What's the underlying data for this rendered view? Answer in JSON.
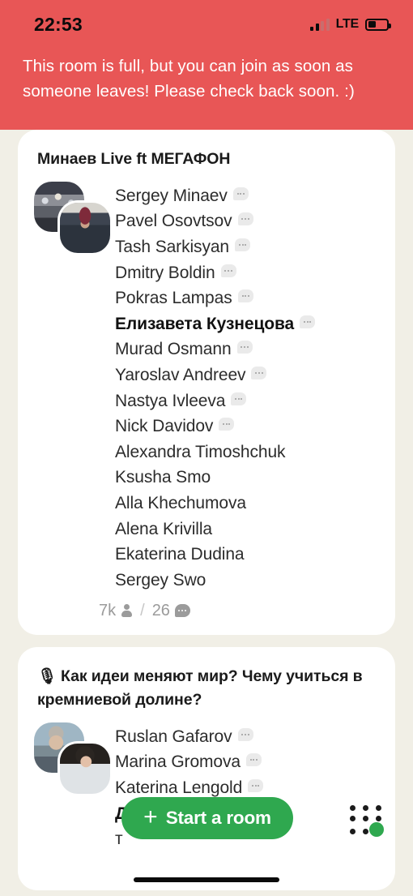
{
  "status_bar": {
    "time": "22:53",
    "network_label": "LTE",
    "signal_icon": "signal-bars-icon",
    "battery_icon": "battery-low-icon"
  },
  "banner": {
    "message": "This room is full, but you can join as soon as someone leaves! Please check back soon. :)",
    "background_color": "#E85656",
    "text_color": "#FFFFFF"
  },
  "rooms": [
    {
      "title": "Минаев Live ft МЕГАФОН",
      "has_mic_icon": false,
      "avatars": [
        "crowd-photo-avatar",
        "man-in-red-hat-avatar"
      ],
      "participants": [
        {
          "name": "Sergey Minaev",
          "has_bubble": true,
          "speaking": false
        },
        {
          "name": "Pavel Osovtsov",
          "has_bubble": true,
          "speaking": false
        },
        {
          "name": "Tash Sarkisyan",
          "has_bubble": true,
          "speaking": false
        },
        {
          "name": "Dmitry Boldin",
          "has_bubble": true,
          "speaking": false
        },
        {
          "name": "Pokras Lampas",
          "has_bubble": true,
          "speaking": false
        },
        {
          "name": "Елизавета Кузнецова",
          "has_bubble": true,
          "speaking": true
        },
        {
          "name": "Murad Osmann",
          "has_bubble": true,
          "speaking": false
        },
        {
          "name": "Yaroslav Andreev",
          "has_bubble": true,
          "speaking": false
        },
        {
          "name": "Nastya Ivleeva",
          "has_bubble": true,
          "speaking": false
        },
        {
          "name": "Nick Davidov",
          "has_bubble": true,
          "speaking": false
        },
        {
          "name": "Alexandra Timoshchuk",
          "has_bubble": false,
          "speaking": false
        },
        {
          "name": "Ksusha Smo",
          "has_bubble": false,
          "speaking": false
        },
        {
          "name": "Alla Khechumova",
          "has_bubble": false,
          "speaking": false
        },
        {
          "name": "Alena Krivilla",
          "has_bubble": false,
          "speaking": false
        },
        {
          "name": "Ekaterina Dudina",
          "has_bubble": false,
          "speaking": false
        },
        {
          "name": "Sergey Swo",
          "has_bubble": false,
          "speaking": false
        }
      ],
      "stats": {
        "listeners": "7k",
        "separator": "/",
        "speakers": "26"
      }
    },
    {
      "title": "Как идеи меняют мир? Чему учиться в кремниевой долине?",
      "has_mic_icon": true,
      "mic_icon": "microphone-icon",
      "avatars": [
        "man-outdoors-avatar",
        "woman-dark-hair-avatar"
      ],
      "participants": [
        {
          "name": "Ruslan Gafarov",
          "has_bubble": true,
          "speaking": false
        },
        {
          "name": "Marina Gromova",
          "has_bubble": true,
          "speaking": false
        },
        {
          "name": "Katerina Lengold",
          "has_bubble": true,
          "speaking": false
        },
        {
          "name": "Д",
          "has_bubble": false,
          "speaking": true
        },
        {
          "name": "т",
          "has_bubble": false,
          "speaking": false
        }
      ]
    }
  ],
  "bottom_bar": {
    "start_room_label": "Start a room",
    "start_room_plus": "+",
    "start_room_color": "#2FA84F",
    "grid_dots_icon": "grid-dots-icon"
  }
}
